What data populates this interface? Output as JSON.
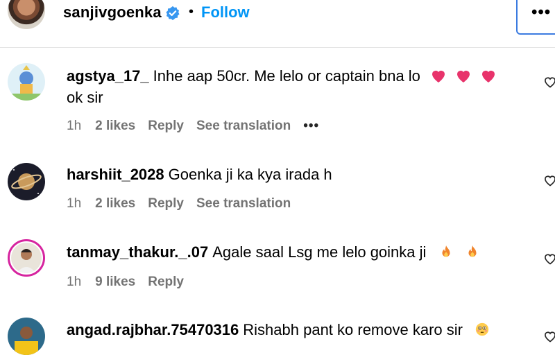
{
  "header": {
    "username": "sanjivgoenka",
    "separator": "•",
    "follow_label": "Follow",
    "more_label": "•••"
  },
  "colors": {
    "accent": "#0095f6",
    "verified": "#3897f0",
    "meta_text": "#737373",
    "focus_border": "#3b7be0"
  },
  "comments": [
    {
      "username": "agstya_17_",
      "text_line1": "Inhe aap 50cr. Me lelo or captain bna lo",
      "text_line2": "ok sir",
      "emojis": [
        "heart-icon",
        "heart-icon",
        "heart-icon"
      ],
      "time": "1h",
      "likes": "2 likes",
      "reply": "Reply",
      "translation": "See translation",
      "more": "•••"
    },
    {
      "username": "harshiit_2028",
      "text_line1": "Goenka ji ka kya irada h",
      "time": "1h",
      "likes": "2 likes",
      "reply": "Reply",
      "translation": "See translation"
    },
    {
      "username": "tanmay_thakur._.07",
      "text_line1": "Agale saal Lsg me lelo goinka ji",
      "emojis": [
        "fire-icon",
        "fire-icon"
      ],
      "time": "1h",
      "likes": "9 likes",
      "reply": "Reply"
    },
    {
      "username": "angad.rajbhar.75470316",
      "text_line1": "Rishabh pant ko remove karo sir",
      "emojis": [
        "flushed-face-icon"
      ]
    }
  ]
}
